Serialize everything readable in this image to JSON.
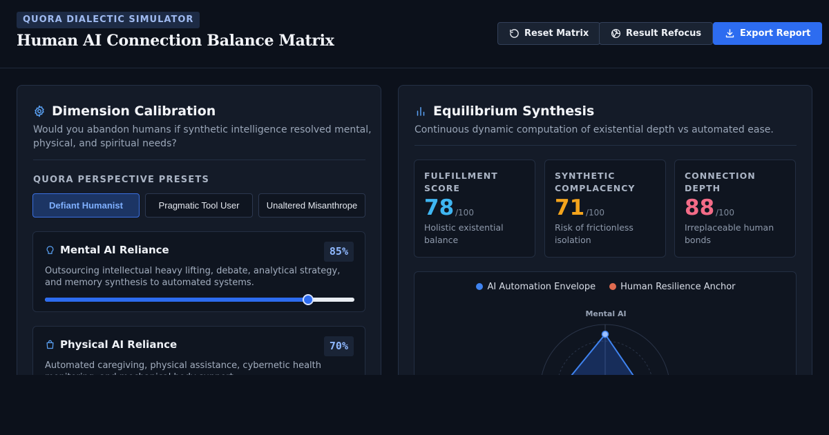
{
  "header": {
    "badge": "QUORA DIALECTIC SIMULATOR",
    "title": "Human AI Connection Balance Matrix",
    "buttons": {
      "reset": "Reset Matrix",
      "refocus": "Result Refocus",
      "export": "Export Report"
    }
  },
  "calibration": {
    "title": "Dimension Calibration",
    "subtitle": "Would you abandon humans if synthetic intelligence resolved mental, physical, and spiritual needs?",
    "presets_label": "QUORA PERSPECTIVE PRESETS",
    "presets": [
      "Defiant Humanist",
      "Pragmatic Tool User",
      "Unaltered Misanthrope"
    ],
    "active_preset": "Defiant Humanist",
    "dimensions": [
      {
        "title": "Mental AI Reliance",
        "percent_label": "85%",
        "value": 85,
        "description": "Outsourcing intellectual heavy lifting, debate, analytical strategy, and memory synthesis to automated systems."
      },
      {
        "title": "Physical AI Reliance",
        "percent_label": "70%",
        "value": 70,
        "description": "Automated caregiving, physical assistance, cybernetic health monitoring, and mechanical body support."
      }
    ]
  },
  "synthesis": {
    "title": "Equilibrium Synthesis",
    "subtitle": "Continuous dynamic computation of existential depth vs automated ease.",
    "metrics": [
      {
        "label": "FULFILLMENT SCORE",
        "value": "78",
        "of": "/100",
        "desc": "Holistic existential balance",
        "color": "#3fb6f2"
      },
      {
        "label": "SYNTHETIC COMPLACENCY",
        "value": "71",
        "of": "/100",
        "desc": "Risk of frictionless isolation",
        "color": "#f4a41c"
      },
      {
        "label": "CONNECTION DEPTH",
        "value": "88",
        "of": "/100",
        "desc": "Irreplaceable human bonds",
        "color": "#f36b87"
      }
    ],
    "radar": {
      "legend": [
        {
          "name": "AI Automation Envelope",
          "color": "#3f83f0"
        },
        {
          "name": "Human Resilience Anchor",
          "color": "#e06b50"
        }
      ],
      "axis_top": "Mental AI",
      "ai_mental_value": 85
    }
  }
}
